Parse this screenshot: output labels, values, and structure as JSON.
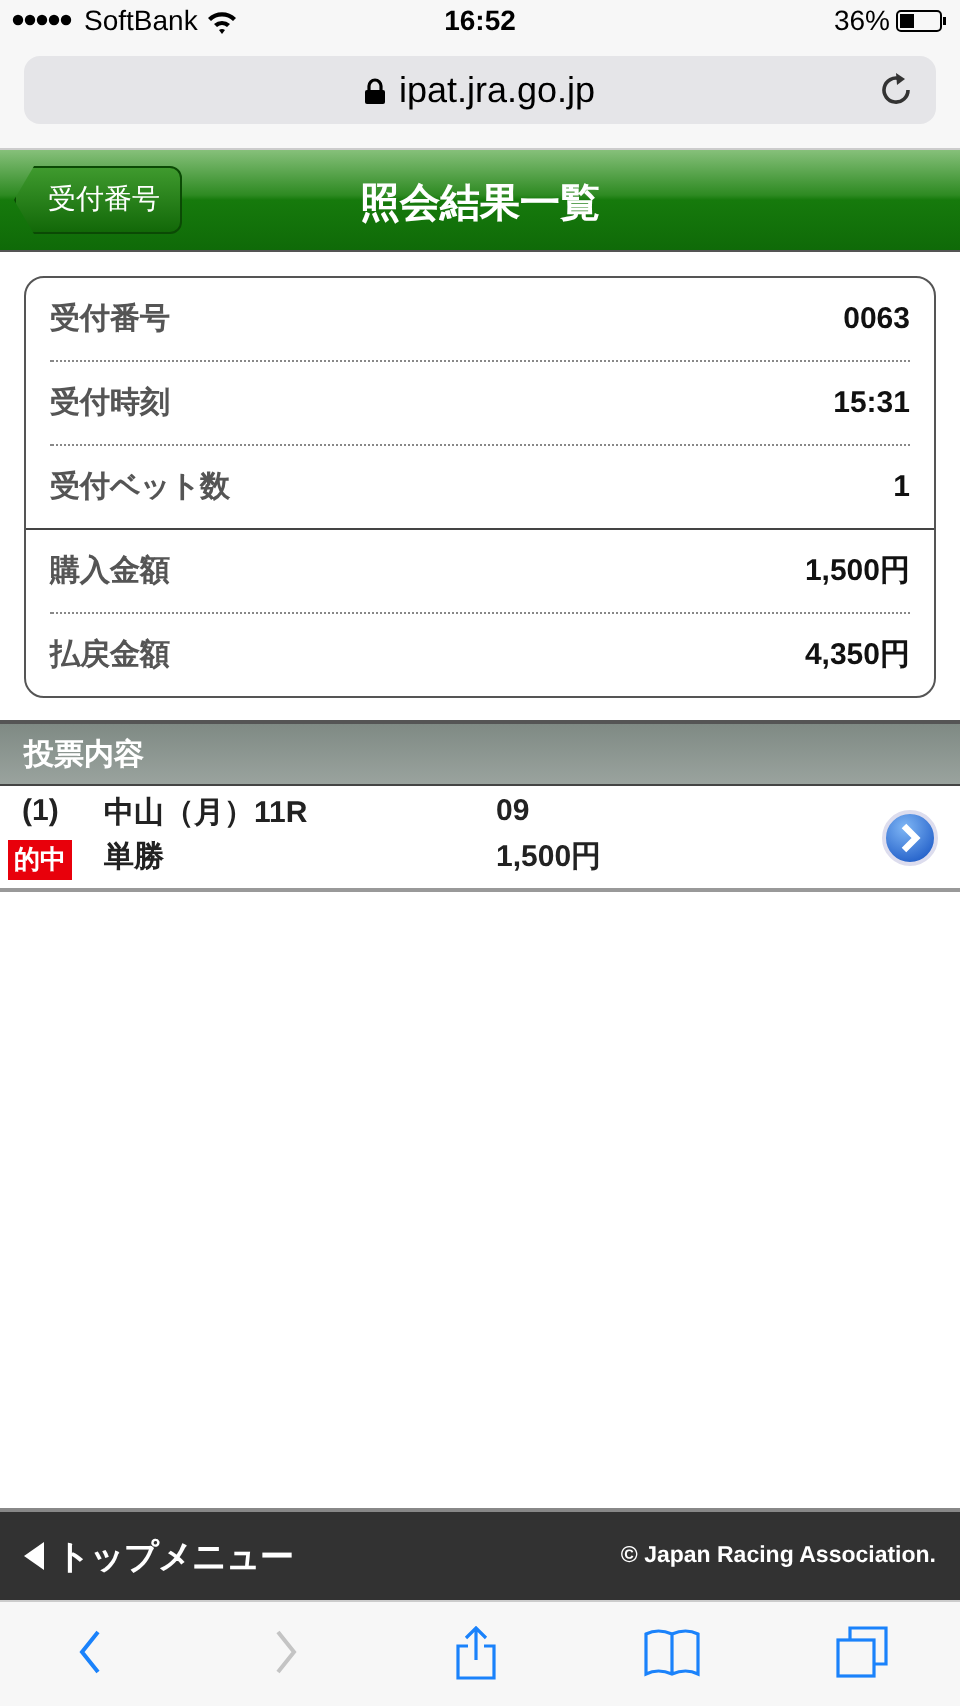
{
  "status_bar": {
    "carrier": "SoftBank",
    "time": "16:52",
    "battery": "36%"
  },
  "url_bar": {
    "address": "ipat.jra.go.jp"
  },
  "header": {
    "back_button": "受付番号",
    "title": "照会結果一覧"
  },
  "summary": {
    "groups": [
      [
        {
          "label": "受付番号",
          "value": "0063"
        },
        {
          "label": "受付時刻",
          "value": "15:31"
        },
        {
          "label": "受付ベット数",
          "value": "1"
        }
      ],
      [
        {
          "label": "購入金額",
          "value": "1,500円"
        },
        {
          "label": "払戻金額",
          "value": "4,350円"
        }
      ]
    ]
  },
  "bets_section": {
    "title": "投票内容",
    "rows": [
      {
        "number": "(1)",
        "race": "中山（月）11R",
        "selection": "09",
        "badge": "的中",
        "bet_type": "単勝",
        "amount": "1,500円"
      }
    ]
  },
  "footer": {
    "top_menu": "トップメニュー",
    "copyright": "© Japan Racing Association."
  },
  "toolbar": [
    {
      "kind": "back",
      "disabled": false
    },
    {
      "kind": "forward",
      "disabled": true
    },
    {
      "kind": "share",
      "disabled": false
    },
    {
      "kind": "bookmarks",
      "disabled": false
    },
    {
      "kind": "tabs",
      "disabled": false
    }
  ]
}
